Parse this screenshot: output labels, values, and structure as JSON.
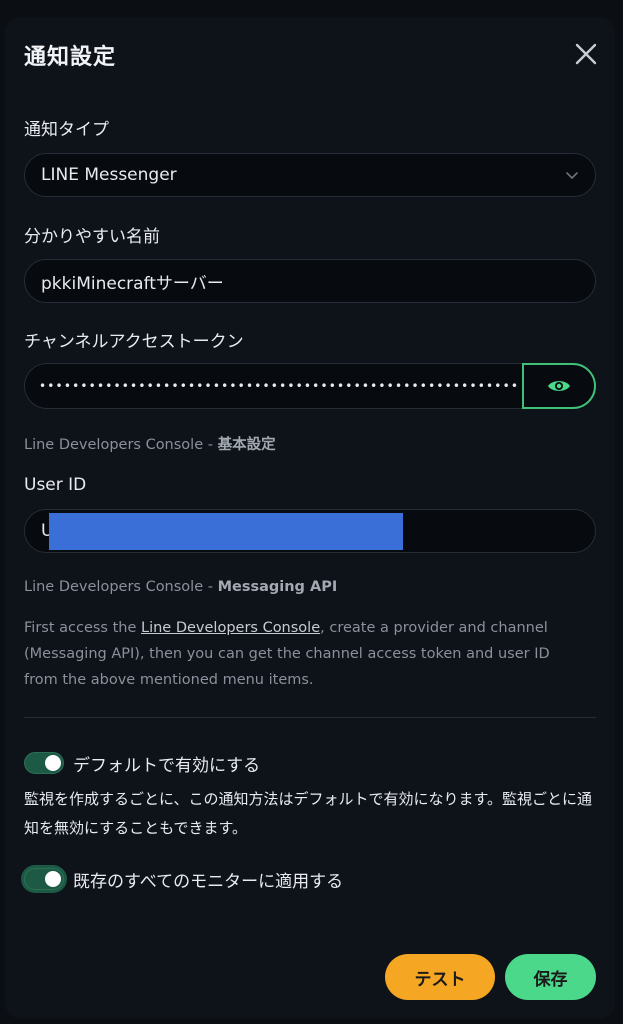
{
  "dialog": {
    "title": "通知設定"
  },
  "notification_type": {
    "label": "通知タイプ",
    "value": "LINE Messenger"
  },
  "friendly_name": {
    "label": "分かりやすい名前",
    "value": "pkkiMinecraftサーバー"
  },
  "access_token": {
    "label": "チャンネルアクセストークン",
    "value": "••••••••••••••••••••••••••••••••••••••••••••••••••••••••••"
  },
  "token_hint": {
    "prefix": "Line Developers Console - ",
    "bold": "基本設定"
  },
  "user_id": {
    "label": "User ID",
    "value": "U",
    "redaction_color": "#3a6fd8"
  },
  "user_id_hint": {
    "prefix": "Line Developers Console - ",
    "bold": "Messaging API"
  },
  "instructions": {
    "before_link": "First access the ",
    "link": "Line Developers Console",
    "after_link": ", create a provider and channel (Messaging API), then you can get the channel access token and user ID from the above mentioned menu items."
  },
  "default_enabled": {
    "label": "デフォルトで有効にする",
    "on": true,
    "description": "監視を作成するごとに、この通知方法はデフォルトで有効になります。監視ごとに通知を無効にすることもできます。"
  },
  "apply_existing": {
    "label": "既存のすべてのモニターに適用する",
    "on": true
  },
  "buttons": {
    "test": "テスト",
    "save": "保存"
  },
  "colors": {
    "accent": "#4cd88a",
    "warning": "#f5a623",
    "background": "#0e1219"
  }
}
